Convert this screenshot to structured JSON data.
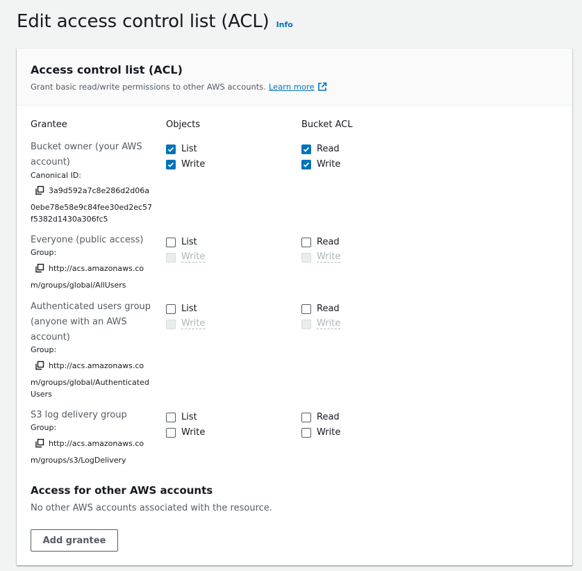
{
  "page": {
    "title": "Edit access control list (ACL)",
    "info_label": "Info"
  },
  "acl": {
    "title": "Access control list (ACL)",
    "description": "Grant basic read/write permissions to other AWS accounts.",
    "learn_more": "Learn more",
    "columns": {
      "grantee": "Grantee",
      "objects": "Objects",
      "bucket_acl": "Bucket ACL"
    }
  },
  "grantees": [
    {
      "name_lines": [
        "Bucket owner (your AWS",
        "account)"
      ],
      "id_label": "Canonical ID:",
      "id_lines": [
        "3a9d592a7c8e286d2d06a",
        "0ebe78e58e9c84fee30ed2ec57",
        "f5382d1430a306fc5"
      ],
      "objects_list": {
        "label": "List",
        "checked": true,
        "disabled": false
      },
      "objects_write": {
        "label": "Write",
        "checked": true,
        "disabled": false
      },
      "bucket_read": {
        "label": "Read",
        "checked": true,
        "disabled": false
      },
      "bucket_write": {
        "label": "Write",
        "checked": true,
        "disabled": false
      }
    },
    {
      "name_lines": [
        "Everyone (public access)"
      ],
      "id_label": "Group:",
      "id_lines": [
        "http://acs.amazonaws.co",
        "m/groups/global/AllUsers"
      ],
      "objects_list": {
        "label": "List",
        "checked": false,
        "disabled": false
      },
      "objects_write": {
        "label": "Write",
        "checked": false,
        "disabled": true
      },
      "bucket_read": {
        "label": "Read",
        "checked": false,
        "disabled": false
      },
      "bucket_write": {
        "label": "Write",
        "checked": false,
        "disabled": true
      }
    },
    {
      "name_lines": [
        "Authenticated users group",
        "(anyone with an AWS",
        "account)"
      ],
      "id_label": "Group:",
      "id_lines": [
        "http://acs.amazonaws.co",
        "m/groups/global/Authenticated",
        "Users"
      ],
      "objects_list": {
        "label": "List",
        "checked": false,
        "disabled": false
      },
      "objects_write": {
        "label": "Write",
        "checked": false,
        "disabled": true
      },
      "bucket_read": {
        "label": "Read",
        "checked": false,
        "disabled": false
      },
      "bucket_write": {
        "label": "Write",
        "checked": false,
        "disabled": true
      }
    },
    {
      "name_lines": [
        "S3 log delivery group"
      ],
      "id_label": "Group:",
      "id_lines": [
        "http://acs.amazonaws.co",
        "m/groups/s3/LogDelivery"
      ],
      "objects_list": {
        "label": "List",
        "checked": false,
        "disabled": false
      },
      "objects_write": {
        "label": "Write",
        "checked": false,
        "disabled": false
      },
      "bucket_read": {
        "label": "Read",
        "checked": false,
        "disabled": false
      },
      "bucket_write": {
        "label": "Write",
        "checked": false,
        "disabled": false
      }
    }
  ],
  "other_accounts": {
    "title": "Access for other AWS accounts",
    "description": "No other AWS accounts associated with the resource.",
    "add_button": "Add grantee"
  },
  "colors": {
    "accent": "#0073bb",
    "text": "#16191f",
    "muted": "#545b64",
    "background": "#f2f3f3"
  }
}
